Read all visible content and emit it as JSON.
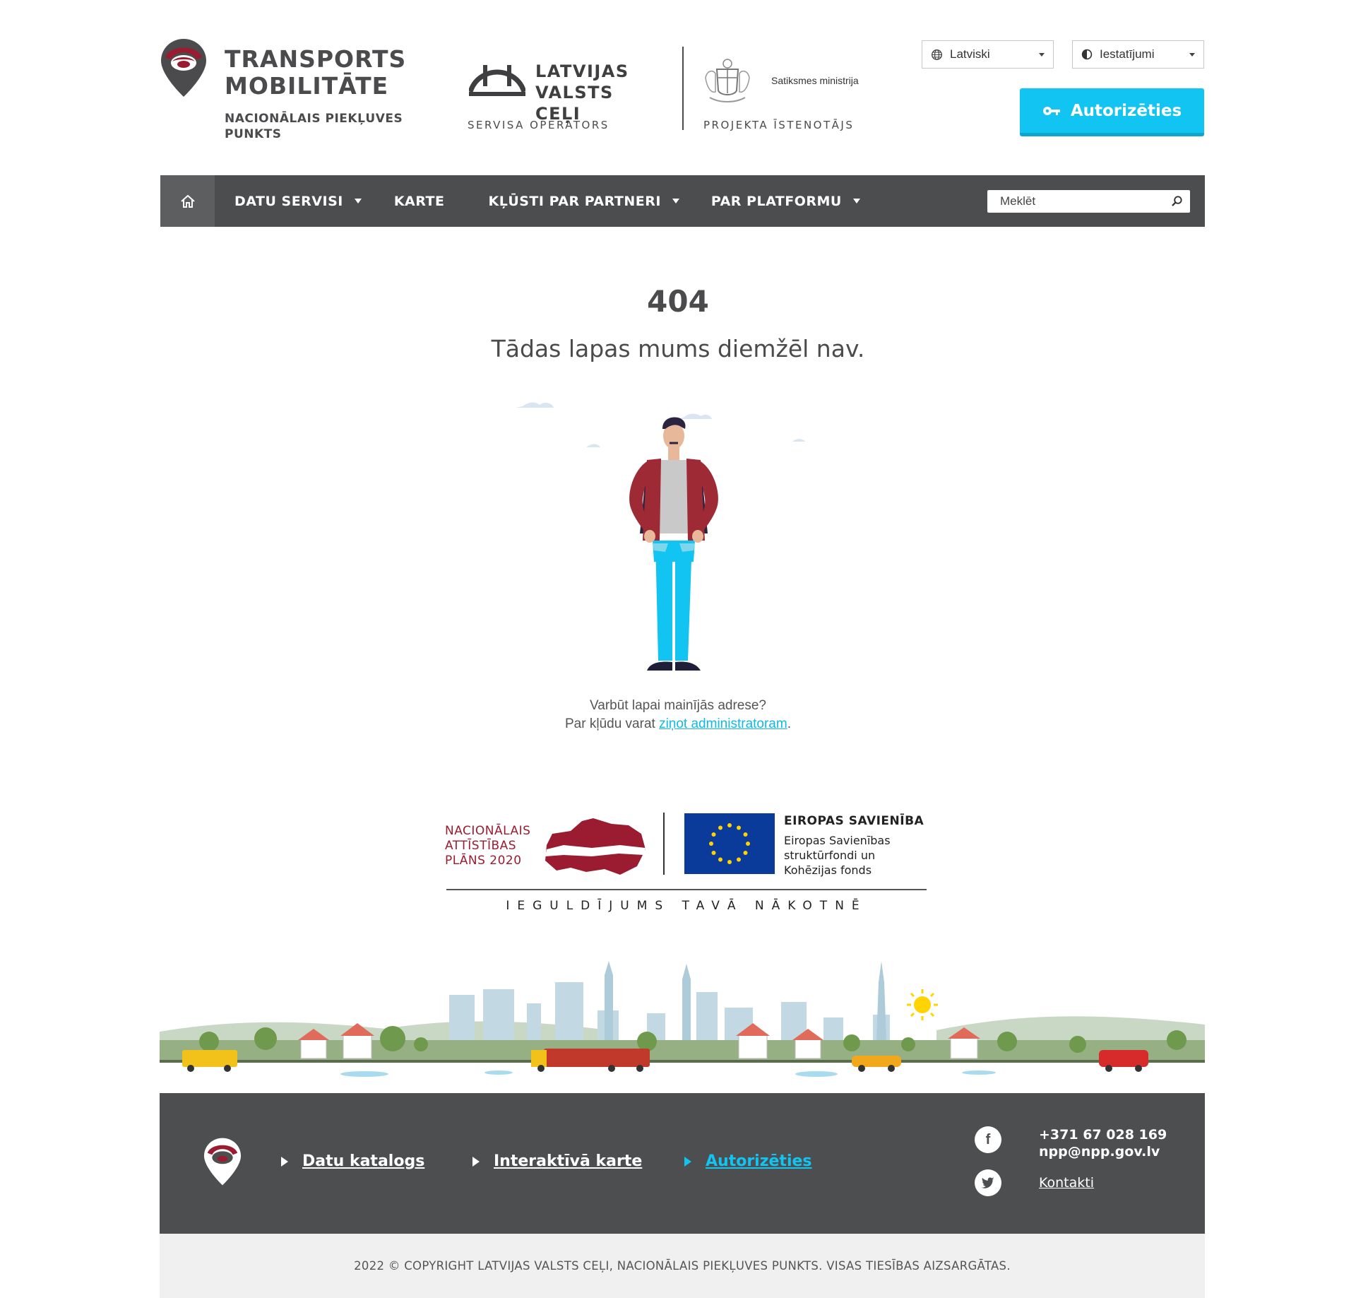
{
  "header": {
    "brand_line1": "TRANSPORTS",
    "brand_line2": "MOBILITĀTE",
    "brand_sub1": "NACIONĀLAIS PIEKĻUVES",
    "brand_sub2": "PUNKTS",
    "operator_line1": "LATVIJAS",
    "operator_line2": "VALSTS CEĻI",
    "operator_caption": "SERVISA OPERATORS",
    "ministry_name": "Satiksmes ministrija",
    "ministry_caption": "PROJEKTA ĪSTENOTĀJS",
    "language_select": "Latviski",
    "settings_select": "Iestatījumi",
    "login_button": "Autorizēties"
  },
  "nav": {
    "items": [
      {
        "label": "DATU SERVISI",
        "dropdown": true
      },
      {
        "label": "KARTE",
        "dropdown": false
      },
      {
        "label": "KĻŪSTI PAR PARTNERI",
        "dropdown": true
      },
      {
        "label": "PAR PLATFORMU",
        "dropdown": true
      }
    ],
    "search_placeholder": "Meklēt"
  },
  "main": {
    "error_code": "404",
    "error_message": "Tādas lapas mums diemžēl nav.",
    "hint_line1": "Varbūt lapai mainījās adrese?",
    "hint_line2_prefix": "Par kļūdu varat ",
    "hint_link": "ziņot administratoram",
    "hint_line2_suffix": "."
  },
  "funding": {
    "nap_line1": "NACIONĀLAIS",
    "nap_line2": "ATTĪSTĪBAS",
    "nap_line3": "PLĀNS 2020",
    "eu_title": "EIROPAS SAVIENĪBA",
    "eu_line1": "Eiropas Savienības",
    "eu_line2": "struktūrfondi un",
    "eu_line3": "Kohēzijas fonds",
    "slogan": "IEGULDĪJUMS TAVĀ NĀKOTNĒ"
  },
  "footer": {
    "links": [
      {
        "label": "Datu katalogs",
        "active": false
      },
      {
        "label": "Interaktīvā karte",
        "active": false
      },
      {
        "label": "Autorizēties",
        "active": true
      }
    ],
    "phone": "+371 67 028 169",
    "email": "npp@npp.gov.lv",
    "contacts_link": "Kontakti",
    "copyright": "2022 © COPYRIGHT LATVIJAS VALSTS CEĻI, NACIONĀLAIS PIEKĻUVES PUNKTS. VISAS TIESĪBAS AIZSARGĀTAS."
  },
  "colors": {
    "accent": "#11c4f2",
    "nav_bg": "#4c4d4f",
    "brand_red": "#9b1c31"
  }
}
